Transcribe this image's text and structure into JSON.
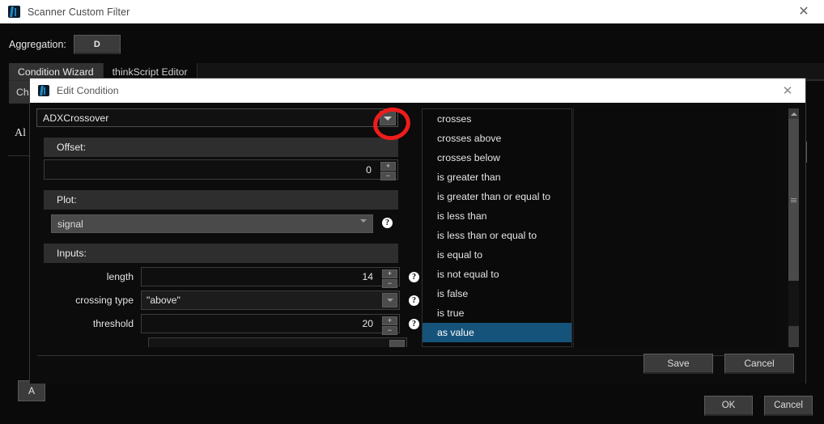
{
  "window": {
    "title": "Scanner Custom Filter",
    "icon": "thinkorswim-icon",
    "close_label": "✕"
  },
  "app": {
    "aggregation_label": "Aggregation:",
    "aggregation_value": "D",
    "tabs": [
      {
        "label": "Condition Wizard",
        "active": true
      },
      {
        "label": "thinkScript Editor",
        "active": false
      }
    ],
    "background_subtab": "Che",
    "background_text": "Al",
    "background_button": "A",
    "footer": {
      "ok_label": "OK",
      "cancel_label": "Cancel"
    }
  },
  "dialog": {
    "title": "Edit Condition",
    "icon": "thinkorswim-icon",
    "close_label": "✕",
    "study_combo": {
      "value": "ADXCrossover",
      "arrow": "chevron-down-icon"
    },
    "offset": {
      "header": "Offset:",
      "value": "0",
      "plus": "+",
      "minus": "−"
    },
    "plot": {
      "header": "Plot:",
      "value": "signal",
      "help": "?"
    },
    "inputs": {
      "header": "Inputs:",
      "rows": [
        {
          "label": "length",
          "value": "14",
          "type": "spinner",
          "help": "?"
        },
        {
          "label": "crossing type",
          "value": "\"above\"",
          "type": "combo",
          "help": "?"
        },
        {
          "label": "threshold",
          "value": "20",
          "type": "spinner",
          "help": "?"
        }
      ]
    },
    "conditions": [
      {
        "label": "crosses",
        "selected": false
      },
      {
        "label": "crosses above",
        "selected": false
      },
      {
        "label": "crosses below",
        "selected": false
      },
      {
        "label": "is greater than",
        "selected": false
      },
      {
        "label": "is greater than or equal to",
        "selected": false
      },
      {
        "label": "is less than",
        "selected": false
      },
      {
        "label": "is less than or equal to",
        "selected": false
      },
      {
        "label": "is equal to",
        "selected": false
      },
      {
        "label": "is not equal to",
        "selected": false
      },
      {
        "label": "is false",
        "selected": false
      },
      {
        "label": "is true",
        "selected": false
      },
      {
        "label": "as value",
        "selected": true
      }
    ],
    "footer": {
      "save_label": "Save",
      "cancel_label": "Cancel"
    }
  },
  "annotation": {
    "shape": "red-circle",
    "color": "#ee1c1c",
    "target": "study-combo-dropdown-arrow"
  },
  "colors": {
    "accent_selected": "#15537a",
    "annotation_red": "#ee1c1c",
    "window_titlebar": "#ffffff",
    "app_background": "#0a0a0a",
    "panel_header": "#2e2e2e"
  }
}
